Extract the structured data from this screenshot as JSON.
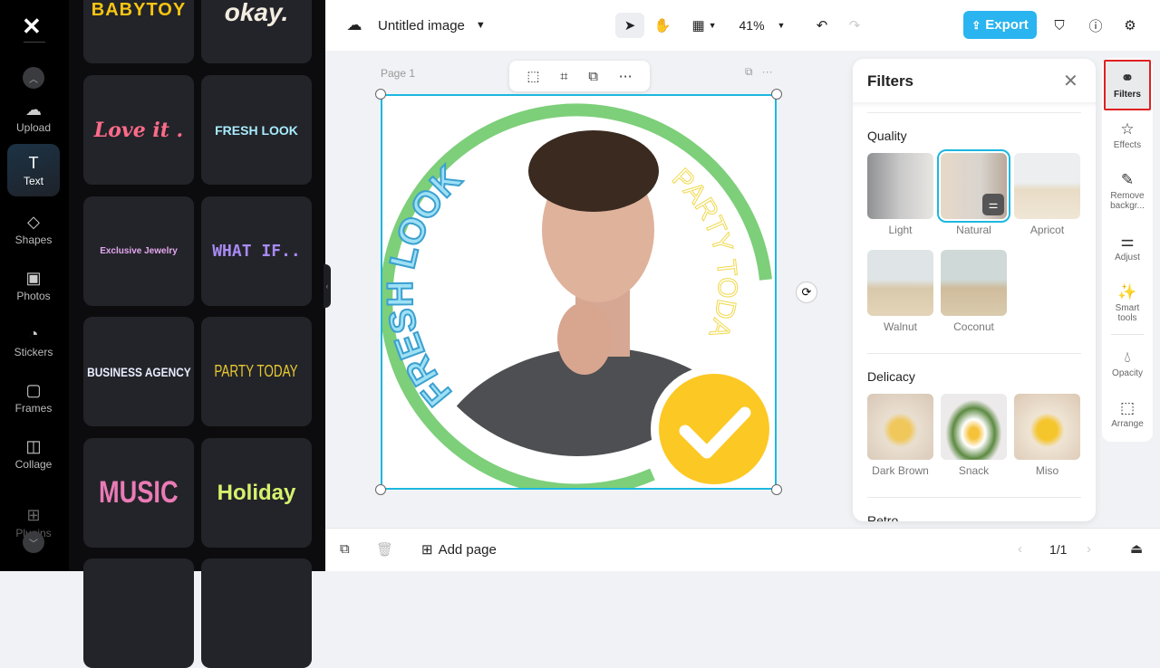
{
  "rail": {
    "items": [
      {
        "label": "Upload",
        "icon": "cloud-upload-icon"
      },
      {
        "label": "Text",
        "icon": "text-icon"
      },
      {
        "label": "Shapes",
        "icon": "shapes-icon"
      },
      {
        "label": "Photos",
        "icon": "image-icon"
      },
      {
        "label": "Stickers",
        "icon": "sticker-icon"
      },
      {
        "label": "Frames",
        "icon": "frame-icon"
      },
      {
        "label": "Collage",
        "icon": "collage-icon"
      },
      {
        "label": "Plugins",
        "icon": "grid-icon"
      }
    ],
    "active": "Text"
  },
  "templates": [
    "BABYTOY",
    "okay.",
    "Love it .",
    "FRESH LOOK",
    "Exclusive Jewelry",
    "WHAT IF..",
    "BUSINESS AGENCY",
    "PARTY TODAY",
    "MUSIC",
    "Holiday"
  ],
  "topbar": {
    "title": "Untitled image",
    "zoom": "41%",
    "export": "Export"
  },
  "canvas": {
    "page_label": "Page 1",
    "curved_left": "FRESH LOOK",
    "curved_right": "PARTY TODAY"
  },
  "bottombar": {
    "add_page": "Add page",
    "pagination": "1/1"
  },
  "filters": {
    "title": "Filters",
    "sections": [
      {
        "name": "Quality",
        "items": [
          "Light",
          "Natural",
          "Apricot",
          "Walnut",
          "Coconut"
        ],
        "selected": "Natural"
      },
      {
        "name": "Delicacy",
        "items": [
          "Dark Brown",
          "Snack",
          "Miso"
        ]
      },
      {
        "name": "Retro",
        "items": []
      }
    ]
  },
  "tools": [
    "Filters",
    "Effects",
    "Remove backgr...",
    "Adjust",
    "Smart tools",
    "Opacity",
    "Arrange"
  ],
  "colors": {
    "accent": "#1cb8e0",
    "export": "#2ab4f0",
    "ring": "#7dcf7a",
    "check": "#fcc824",
    "highlight": "#e02020"
  }
}
